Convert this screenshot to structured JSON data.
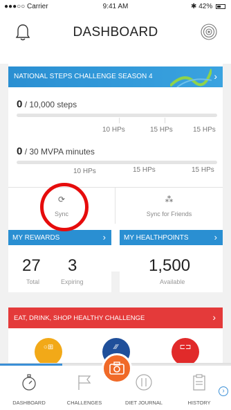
{
  "status_bar": {
    "carrier": "●●●○○ Carrier",
    "time": "9:41 AM",
    "battery": "42%"
  },
  "header": {
    "title": "DASHBOARD",
    "left_icon": "bell-icon",
    "right_icon": "broadcast-icon"
  },
  "steps_challenge": {
    "title": "NATIONAL STEPS CHALLENGE SEASON 4",
    "steps": {
      "current": "0",
      "goal_text": "/ 10,000 steps",
      "progress": 0
    },
    "mvpa": {
      "current": "0",
      "goal_text": "/ 30 MVPA minutes",
      "progress": 0
    },
    "steps_hp_labels": [
      "10 HPs",
      "15 HPs",
      "15 HPs"
    ],
    "mvpa_hp_labels": [
      "10 HPs",
      "15 HPs",
      "15 HPs"
    ]
  },
  "sync": {
    "sync_label": "Sync",
    "sync_friends_label": "Sync for Friends",
    "sync_icon": "refresh-icon",
    "friends_icon": "friends-icon"
  },
  "rewards": {
    "title": "MY REWARDS",
    "total_value": "27",
    "total_label": "Total",
    "expiring_value": "3",
    "expiring_label": "Expiring"
  },
  "healthpoints": {
    "title": "MY HEALTHPOINTS",
    "value": "1,500",
    "label": "Available"
  },
  "eat_challenge": {
    "title": "EAT, DRINK, SHOP HEALTHY CHALLENGE"
  },
  "tabs": [
    {
      "label": "DASHBOARD",
      "icon": "stopwatch-icon"
    },
    {
      "label": "CHALLENGES",
      "icon": "flag-icon"
    },
    {
      "label": "DIET JOURNAL",
      "icon": "cutlery-icon"
    },
    {
      "label": "HISTORY",
      "icon": "clipboard-icon"
    }
  ],
  "colors": {
    "accent_blue": "#2a8fd2",
    "accent_red": "#e43a3a",
    "camera_orange": "#f06a28",
    "highlight_ring": "#e60c0c"
  }
}
